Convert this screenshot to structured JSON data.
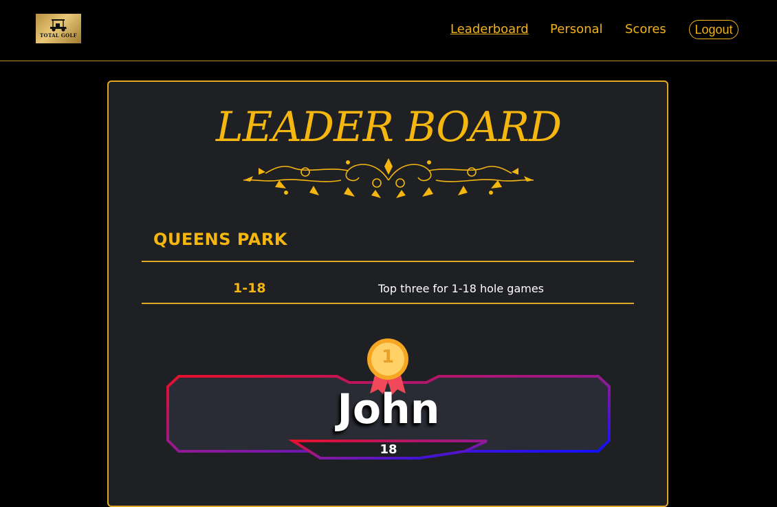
{
  "header": {
    "logo_text": "TOTAL GOLF",
    "nav": {
      "leaderboard": "Leaderboard",
      "personal": "Personal",
      "scores": "Scores",
      "logout": "Logout"
    }
  },
  "main": {
    "title": "LEADER BOARD",
    "course": "QUEENS PARK",
    "category": {
      "range": "1-18",
      "description": "Top three for 1-18 hole games"
    },
    "leaders": [
      {
        "rank": "1",
        "name": "John",
        "score": "18"
      }
    ]
  },
  "colors": {
    "accent": "#f5b70f",
    "card_bg": "#1f2024",
    "page_bg": "#000000",
    "frame_gradient_start": "#e8102a",
    "frame_gradient_end": "#1010ff"
  },
  "icons": [
    "golf-cart-icon",
    "flourish-ornament",
    "gold-medal-icon"
  ]
}
